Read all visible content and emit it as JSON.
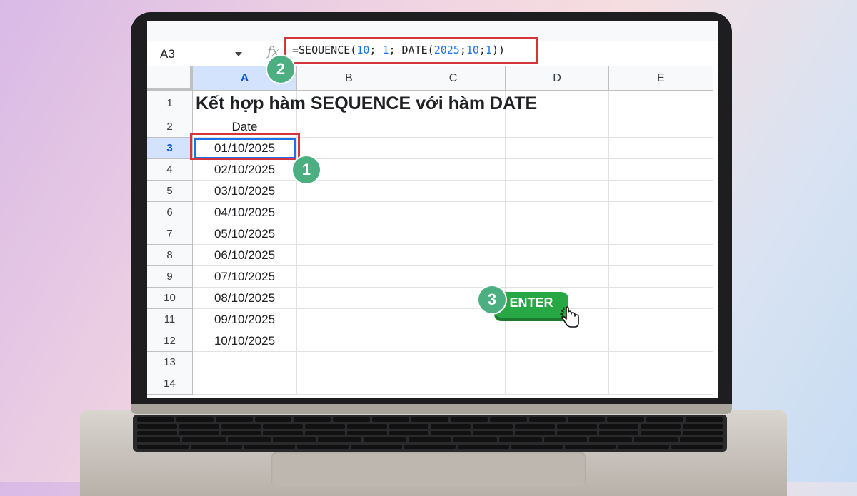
{
  "formula_bar": {
    "cell_ref": "A3",
    "fx_label": "fx",
    "formula_parts": [
      {
        "t": "=SEQUENCE(",
        "num": false
      },
      {
        "t": "10",
        "num": true
      },
      {
        "t": "; ",
        "num": false
      },
      {
        "t": "1",
        "num": true
      },
      {
        "t": "; DATE(",
        "num": false
      },
      {
        "t": "2025",
        "num": true
      },
      {
        "t": ";",
        "num": false
      },
      {
        "t": "10",
        "num": true
      },
      {
        "t": ";",
        "num": false
      },
      {
        "t": "1",
        "num": true
      },
      {
        "t": "))",
        "num": false
      }
    ]
  },
  "sheet": {
    "columns": [
      "A",
      "B",
      "C",
      "D",
      "E"
    ],
    "selected_column": "A",
    "rows": [
      "1",
      "2",
      "3",
      "4",
      "5",
      "6",
      "7",
      "8",
      "9",
      "10",
      "11",
      "12",
      "13",
      "14"
    ],
    "selected_row": "3",
    "title": "Kết hợp hàm SEQUENCE với hàm DATE",
    "header": "Date",
    "dates": [
      "01/10/2025",
      "02/10/2025",
      "03/10/2025",
      "04/10/2025",
      "05/10/2025",
      "06/10/2025",
      "07/10/2025",
      "08/10/2025",
      "09/10/2025",
      "10/10/2025"
    ]
  },
  "annotations": {
    "badge_1": "1",
    "badge_2": "2",
    "badge_3": "3",
    "enter_label": "ENTER"
  },
  "colors": {
    "highlight_red": "#d3353a",
    "badge_green": "#4caf82",
    "enter_green": "#27a844",
    "selection_blue": "#1a73e8"
  },
  "icons": {
    "fx": "fx-icon",
    "cursor": "hand-pointer-icon",
    "dropdown": "chevron-down-icon"
  }
}
